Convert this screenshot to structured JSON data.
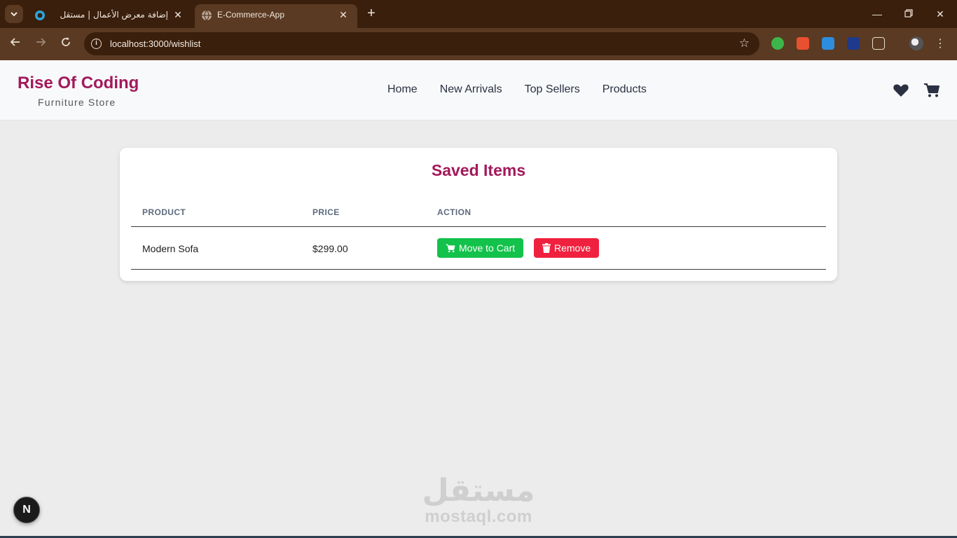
{
  "browser": {
    "tabs": [
      {
        "title": "إضافة معرض الأعمال | مستقل",
        "favicon": "mostaql-icon",
        "active": false
      },
      {
        "title": "E-Commerce-App",
        "favicon": "globe-icon",
        "active": true
      }
    ],
    "url": "localhost:3000/wishlist"
  },
  "header": {
    "brand": "Rise Of Coding",
    "tagline": "Furniture Store",
    "nav": [
      "Home",
      "New Arrivals",
      "Top Sellers",
      "Products"
    ],
    "icons": [
      "heart-icon",
      "cart-icon"
    ]
  },
  "wishlist": {
    "title": "Saved Items",
    "columns": [
      "PRODUCT",
      "PRICE",
      "ACTION"
    ],
    "rows": [
      {
        "product": "Modern Sofa",
        "price": "$299.00",
        "move_label": "Move to Cart",
        "remove_label": "Remove"
      }
    ]
  },
  "watermark": {
    "arabic": "مستقل",
    "latin": "mostaql.com"
  },
  "dev_badge": "N",
  "colors": {
    "brand": "#a3195b",
    "move_button": "#12c24a",
    "remove_button": "#f0213e",
    "chrome": "#3a1f0c"
  }
}
